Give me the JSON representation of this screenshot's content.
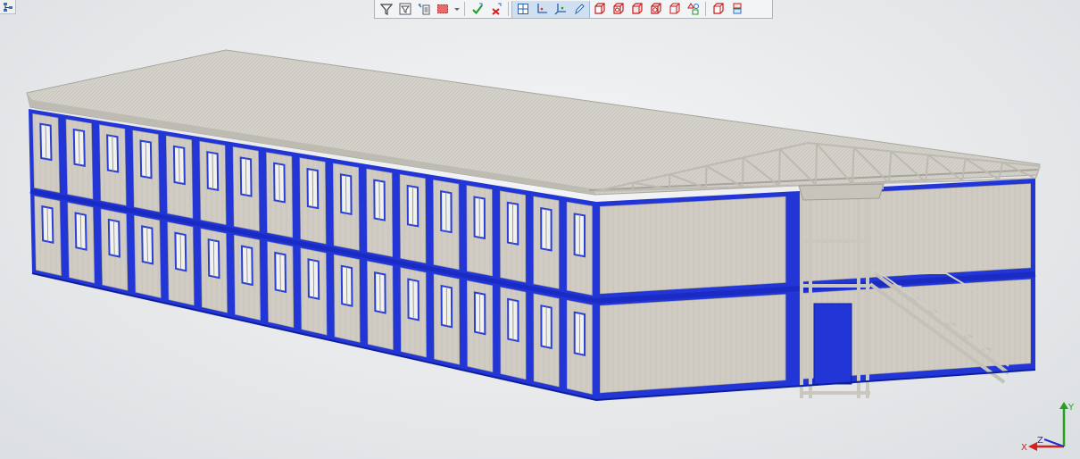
{
  "viewport": {
    "description_label": "",
    "colors": {
      "frame_blue": "#1a2fd6",
      "panel_gray": "#cfcbc3",
      "roof_gray": "#d2d0c8",
      "truss_gray": "#c8c6bd",
      "background": "#e8eaec"
    }
  },
  "toolbar": {
    "buttons": [
      {
        "name": "filter-icon"
      },
      {
        "name": "filter-settings-icon"
      },
      {
        "name": "select-list-icon"
      },
      {
        "name": "select-box-icon"
      },
      {
        "name": "dropdown-arrow-icon"
      },
      {
        "name": "accept-check-icon"
      },
      {
        "name": "reject-x-icon"
      },
      {
        "name": "view-plane-icon"
      },
      {
        "name": "axis-xy-icon"
      },
      {
        "name": "axis-xyz-icon"
      },
      {
        "name": "edit-pencil-icon"
      },
      {
        "name": "solid-cube-icon"
      },
      {
        "name": "cube-section-icon"
      },
      {
        "name": "cube-shaded-icon"
      },
      {
        "name": "cube-outline-icon"
      },
      {
        "name": "cube-wire-icon"
      },
      {
        "name": "shapes-icon"
      },
      {
        "name": "render-cube-icon"
      },
      {
        "name": "layers-icon"
      }
    ]
  },
  "axis_triad": {
    "x_label": "X",
    "y_label": "Y",
    "z_label": "Z",
    "colors": {
      "x": "#d42020",
      "y": "#23a123",
      "z": "#2030c8"
    }
  }
}
